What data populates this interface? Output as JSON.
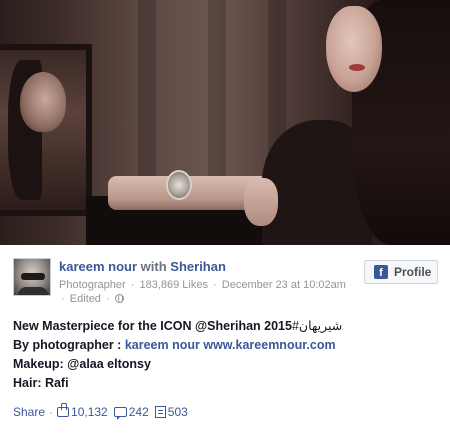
{
  "post": {
    "author": "kareem nour",
    "with_word": "with",
    "tagged": "Sherihan",
    "profile_button": "Profile",
    "meta": {
      "role": "Photographer",
      "likes_text": "183,869 Likes",
      "date": "December 23 at 10:02am",
      "edited": "Edited"
    },
    "caption": {
      "line1_text": "New Masterpiece for the ICON @Sherihan 2015",
      "line1_hashtag": "#شيريهان",
      "line2_prefix": "By photographer :",
      "line2_name": "kareem nour",
      "line2_site": "www.kareemnour.com",
      "line3": "Makeup: @alaa eltonsy",
      "line4": "Hair: Rafi"
    },
    "footer": {
      "share": "Share",
      "likes": "10,132",
      "comments": "242",
      "shares": "503"
    }
  },
  "icons": {
    "facebook": "facebook-icon",
    "globe": "globe-icon",
    "like": "thumbs-up-icon",
    "comment": "comment-icon",
    "shares": "share-icon"
  },
  "colors": {
    "link": "#3b5998",
    "meta": "#90949c",
    "text": "#141823"
  }
}
